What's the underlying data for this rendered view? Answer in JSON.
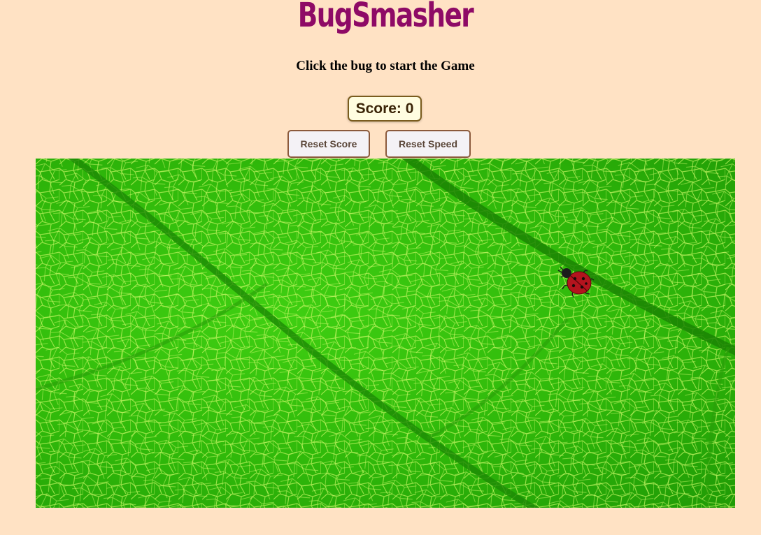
{
  "app": {
    "title": "BugSmasher",
    "instruction": "Click the bug to start the Game"
  },
  "score": {
    "label": "Score: 0",
    "value": 0
  },
  "buttons": {
    "reset_score": "Reset Score",
    "reset_speed": "Reset Speed"
  },
  "board": {
    "background": "green leaf texture",
    "bug": "ladybug"
  },
  "colors": {
    "page_background": "#ffe2c4",
    "title": "#8e0a66",
    "leaf_green": "#33bf0c",
    "ladybug_red": "#b3141e"
  }
}
